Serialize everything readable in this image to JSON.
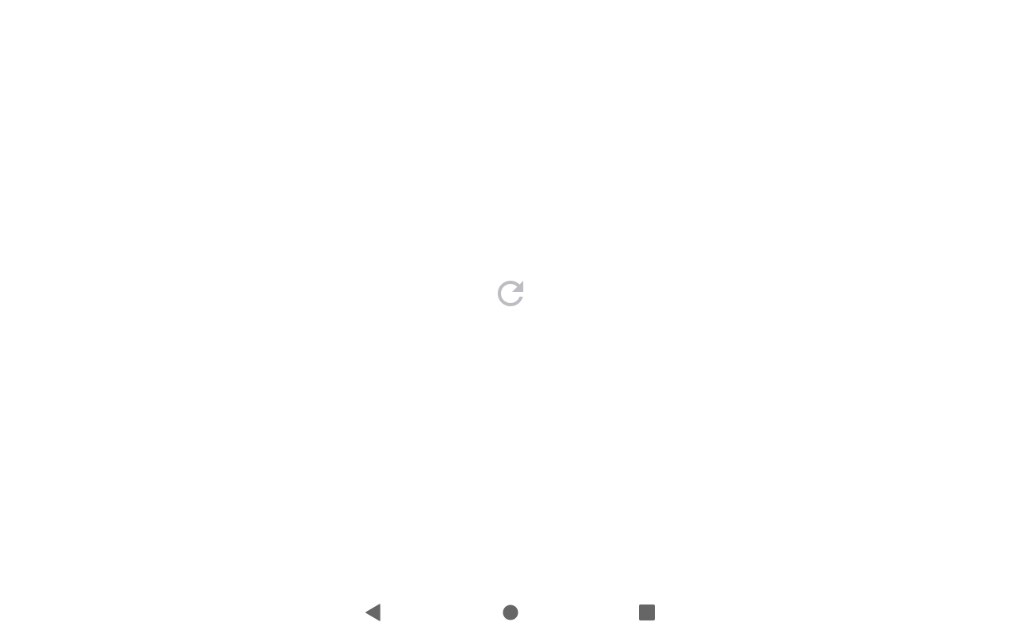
{
  "page": {
    "background": "#ffffff"
  },
  "content": {
    "reload_icon": "reload-icon",
    "icon_color": "#bcbcc2",
    "state": "loading / reload placeholder"
  },
  "navigation_bar": {
    "icon_color": "#666666",
    "buttons": [
      {
        "name": "back",
        "icon": "back-triangle-icon"
      },
      {
        "name": "home",
        "icon": "home-circle-icon"
      },
      {
        "name": "recents",
        "icon": "recents-square-icon"
      }
    ]
  }
}
